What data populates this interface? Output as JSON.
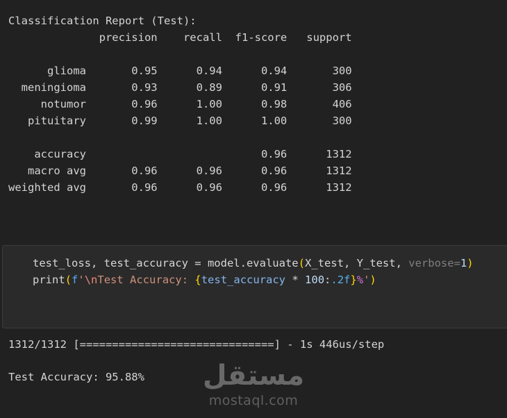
{
  "report": {
    "title": "Classification Report (Test):",
    "headers": [
      "precision",
      "recall",
      "f1-score",
      "support"
    ],
    "rows": [
      {
        "label": "glioma",
        "precision": "0.95",
        "recall": "0.94",
        "f1": "0.94",
        "support": "300"
      },
      {
        "label": "meningioma",
        "precision": "0.93",
        "recall": "0.89",
        "f1": "0.91",
        "support": "306"
      },
      {
        "label": "notumor",
        "precision": "0.96",
        "recall": "1.00",
        "f1": "0.98",
        "support": "406"
      },
      {
        "label": "pituitary",
        "precision": "0.99",
        "recall": "1.00",
        "f1": "1.00",
        "support": "300"
      }
    ],
    "summary": [
      {
        "label": "accuracy",
        "precision": "",
        "recall": "",
        "f1": "0.96",
        "support": "1312"
      },
      {
        "label": "macro avg",
        "precision": "0.96",
        "recall": "0.96",
        "f1": "0.96",
        "support": "1312"
      },
      {
        "label": "weighted avg",
        "precision": "0.96",
        "recall": "0.96",
        "f1": "0.96",
        "support": "1312"
      }
    ]
  },
  "code": {
    "lines": [
      [
        {
          "t": "test_loss, test_accuracy = model.evaluate",
          "c": "plain"
        },
        {
          "t": "(",
          "c": "bracket"
        },
        {
          "t": "X_test, Y_test, ",
          "c": "plain"
        },
        {
          "t": "verbose=",
          "c": "param"
        },
        {
          "t": "1",
          "c": "number"
        },
        {
          "t": ")",
          "c": "bracket"
        }
      ],
      [
        {
          "t": "print",
          "c": "plain"
        },
        {
          "t": "(",
          "c": "bracket"
        },
        {
          "t": "f",
          "c": "fprefix"
        },
        {
          "t": "'",
          "c": "string"
        },
        {
          "t": "\\n",
          "c": "escape"
        },
        {
          "t": "Test Accuracy: ",
          "c": "string"
        },
        {
          "t": "{",
          "c": "bracket"
        },
        {
          "t": "test_accuracy ",
          "c": "variable"
        },
        {
          "t": "* ",
          "c": "plain"
        },
        {
          "t": "100",
          "c": "number"
        },
        {
          "t": ":",
          "c": "plain"
        },
        {
          "t": ".2f",
          "c": "formatspec"
        },
        {
          "t": "}",
          "c": "bracket"
        },
        {
          "t": "%",
          "c": "percent"
        },
        {
          "t": "'",
          "c": "string"
        },
        {
          "t": ")",
          "c": "bracket"
        }
      ]
    ]
  },
  "output": {
    "progress_line": "1312/1312 [==============================] - 1s 446us/step",
    "accuracy_line": "Test Accuracy: 95.88%"
  },
  "watermark": {
    "arabic": "مستقل",
    "domain": "mostaql.com"
  },
  "colors": {
    "page_bg": "#212121",
    "cell_bg": "#2a2a2b",
    "cell_border": "#3c3c3c",
    "report_text": "#d4d4d4",
    "watermark_text": "#6f6f6f",
    "tokens": {
      "plain": "#d6d6d6",
      "bracket": "#ffd700",
      "param": "#7f7f7f",
      "number": "#bfd8f2",
      "fprefix": "#58a9f5",
      "string": "#ce9178",
      "escape": "#ea8a74",
      "variable": "#83b4e8",
      "formatspec": "#57b2e8",
      "percent": "#da70d6"
    }
  }
}
